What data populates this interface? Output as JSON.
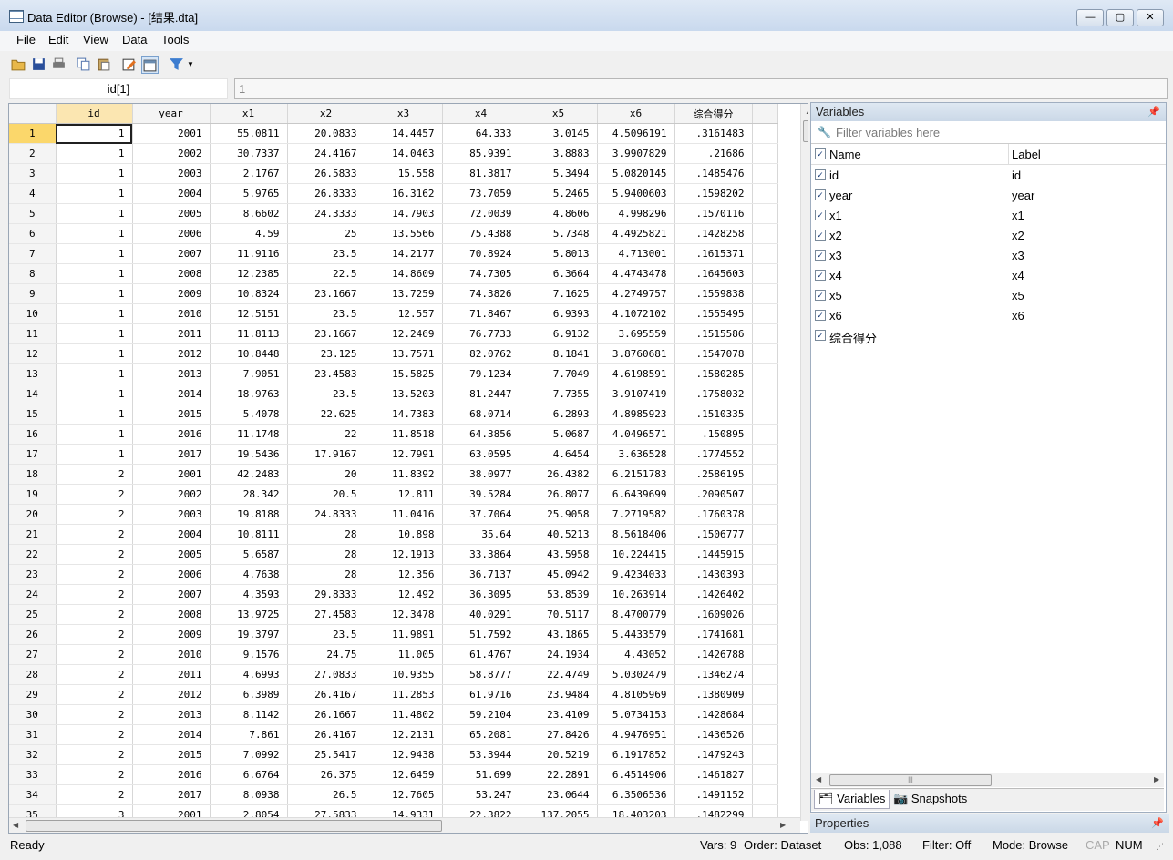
{
  "window": {
    "title": "Data Editor (Browse) - [结果.dta]"
  },
  "menu": [
    "File",
    "Edit",
    "View",
    "Data",
    "Tools"
  ],
  "cmd": {
    "varname": "id[1]",
    "value": "1"
  },
  "grid": {
    "columns": [
      "id",
      "year",
      "x1",
      "x2",
      "x3",
      "x4",
      "x5",
      "x6",
      "综合得分"
    ],
    "rows": [
      [
        "1",
        "2001",
        "55.0811",
        "20.0833",
        "14.4457",
        "64.333",
        "3.0145",
        "4.5096191",
        ".3161483"
      ],
      [
        "1",
        "2002",
        "30.7337",
        "24.4167",
        "14.0463",
        "85.9391",
        "3.8883",
        "3.9907829",
        ".21686"
      ],
      [
        "1",
        "2003",
        "2.1767",
        "26.5833",
        "15.558",
        "81.3817",
        "5.3494",
        "5.0820145",
        ".1485476"
      ],
      [
        "1",
        "2004",
        "5.9765",
        "26.8333",
        "16.3162",
        "73.7059",
        "5.2465",
        "5.9400603",
        ".1598202"
      ],
      [
        "1",
        "2005",
        "8.6602",
        "24.3333",
        "14.7903",
        "72.0039",
        "4.8606",
        "4.998296",
        ".1570116"
      ],
      [
        "1",
        "2006",
        "4.59",
        "25",
        "13.5566",
        "75.4388",
        "5.7348",
        "4.4925821",
        ".1428258"
      ],
      [
        "1",
        "2007",
        "11.9116",
        "23.5",
        "14.2177",
        "70.8924",
        "5.8013",
        "4.713001",
        ".1615371"
      ],
      [
        "1",
        "2008",
        "12.2385",
        "22.5",
        "14.8609",
        "74.7305",
        "6.3664",
        "4.4743478",
        ".1645603"
      ],
      [
        "1",
        "2009",
        "10.8324",
        "23.1667",
        "13.7259",
        "74.3826",
        "7.1625",
        "4.2749757",
        ".1559838"
      ],
      [
        "1",
        "2010",
        "12.5151",
        "23.5",
        "12.557",
        "71.8467",
        "6.9393",
        "4.1072102",
        ".1555495"
      ],
      [
        "1",
        "2011",
        "11.8113",
        "23.1667",
        "12.2469",
        "76.7733",
        "6.9132",
        "3.695559",
        ".1515586"
      ],
      [
        "1",
        "2012",
        "10.8448",
        "23.125",
        "13.7571",
        "82.0762",
        "8.1841",
        "3.8760681",
        ".1547078"
      ],
      [
        "1",
        "2013",
        "7.9051",
        "23.4583",
        "15.5825",
        "79.1234",
        "7.7049",
        "4.6198591",
        ".1580285"
      ],
      [
        "1",
        "2014",
        "18.9763",
        "23.5",
        "13.5203",
        "81.2447",
        "7.7355",
        "3.9107419",
        ".1758032"
      ],
      [
        "1",
        "2015",
        "5.4078",
        "22.625",
        "14.7383",
        "68.0714",
        "6.2893",
        "4.8985923",
        ".1510335"
      ],
      [
        "1",
        "2016",
        "11.1748",
        "22",
        "11.8518",
        "64.3856",
        "5.0687",
        "4.0496571",
        ".150895"
      ],
      [
        "1",
        "2017",
        "19.5436",
        "17.9167",
        "12.7991",
        "63.0595",
        "4.6454",
        "3.636528",
        ".1774552"
      ],
      [
        "2",
        "2001",
        "42.2483",
        "20",
        "11.8392",
        "38.0977",
        "26.4382",
        "6.2151783",
        ".2586195"
      ],
      [
        "2",
        "2002",
        "28.342",
        "20.5",
        "12.811",
        "39.5284",
        "26.8077",
        "6.6439699",
        ".2090507"
      ],
      [
        "2",
        "2003",
        "19.8188",
        "24.8333",
        "11.0416",
        "37.7064",
        "25.9058",
        "7.2719582",
        ".1760378"
      ],
      [
        "2",
        "2004",
        "10.8111",
        "28",
        "10.898",
        "35.64",
        "40.5213",
        "8.5618406",
        ".1506777"
      ],
      [
        "2",
        "2005",
        "5.6587",
        "28",
        "12.1913",
        "33.3864",
        "43.5958",
        "10.224415",
        ".1445915"
      ],
      [
        "2",
        "2006",
        "4.7638",
        "28",
        "12.356",
        "36.7137",
        "45.0942",
        "9.4234033",
        ".1430393"
      ],
      [
        "2",
        "2007",
        "4.3593",
        "29.8333",
        "12.492",
        "36.3095",
        "53.8539",
        "10.263914",
        ".1426402"
      ],
      [
        "2",
        "2008",
        "13.9725",
        "27.4583",
        "12.3478",
        "40.0291",
        "70.5117",
        "8.4700779",
        ".1609026"
      ],
      [
        "2",
        "2009",
        "19.3797",
        "23.5",
        "11.9891",
        "51.7592",
        "43.1865",
        "5.4433579",
        ".1741681"
      ],
      [
        "2",
        "2010",
        "9.1576",
        "24.75",
        "11.005",
        "61.4767",
        "24.1934",
        "4.43052",
        ".1426788"
      ],
      [
        "2",
        "2011",
        "4.6993",
        "27.0833",
        "10.9355",
        "58.8777",
        "22.4749",
        "5.0302479",
        ".1346274"
      ],
      [
        "2",
        "2012",
        "6.3989",
        "26.4167",
        "11.2853",
        "61.9716",
        "23.9484",
        "4.8105969",
        ".1380909"
      ],
      [
        "2",
        "2013",
        "8.1142",
        "26.1667",
        "11.4802",
        "59.2104",
        "23.4109",
        "5.0734153",
        ".1428684"
      ],
      [
        "2",
        "2014",
        "7.861",
        "26.4167",
        "12.2131",
        "65.2081",
        "27.8426",
        "4.9476951",
        ".1436526"
      ],
      [
        "2",
        "2015",
        "7.0992",
        "25.5417",
        "12.9438",
        "53.3944",
        "20.5219",
        "6.1917852",
        ".1479243"
      ],
      [
        "2",
        "2016",
        "6.6764",
        "26.375",
        "12.6459",
        "51.699",
        "22.2891",
        "6.4514906",
        ".1461827"
      ],
      [
        "2",
        "2017",
        "8.0938",
        "26.5",
        "12.7605",
        "53.247",
        "23.0644",
        "6.3506536",
        ".1491152"
      ],
      [
        "3",
        "2001",
        "2.8054",
        "27.5833",
        "14.9331",
        "22.3822",
        "137.2055",
        "18.403203",
        ".1482299"
      ]
    ]
  },
  "variables_panel": {
    "title": "Variables",
    "filter_placeholder": "Filter variables here",
    "col_name": "Name",
    "col_label": "Label",
    "vars": [
      {
        "name": "id",
        "label": "id"
      },
      {
        "name": "year",
        "label": "year"
      },
      {
        "name": "x1",
        "label": "x1"
      },
      {
        "name": "x2",
        "label": "x2"
      },
      {
        "name": "x3",
        "label": "x3"
      },
      {
        "name": "x4",
        "label": "x4"
      },
      {
        "name": "x5",
        "label": "x5"
      },
      {
        "name": "x6",
        "label": "x6"
      },
      {
        "name": "综合得分",
        "label": ""
      }
    ],
    "tabs": [
      "Variables",
      "Snapshots"
    ]
  },
  "properties_panel": {
    "title": "Properties"
  },
  "status": {
    "ready": "Ready",
    "vars": "Vars: 9",
    "order": "Order: Dataset",
    "obs": "Obs: 1,088",
    "filter": "Filter: Off",
    "mode": "Mode: Browse",
    "cap": "CAP",
    "num": "NUM"
  }
}
